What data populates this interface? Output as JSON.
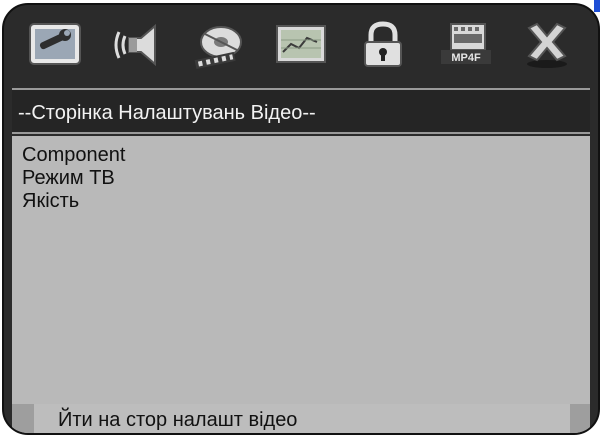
{
  "toolbar": {
    "icons": [
      {
        "name": "general-setup-icon"
      },
      {
        "name": "audio-setup-icon"
      },
      {
        "name": "video-setup-icon"
      },
      {
        "name": "preferences-icon"
      },
      {
        "name": "password-lock-icon"
      },
      {
        "name": "mp4-setup-icon"
      },
      {
        "name": "exit-icon"
      }
    ]
  },
  "header": {
    "title": "--Сторінка Налаштувань Відео--"
  },
  "menu": {
    "items": [
      {
        "label": "Component"
      },
      {
        "label": "Режим ТВ"
      },
      {
        "label": "Якість"
      }
    ]
  },
  "footer": {
    "hint": "Йти на стор налашт відео"
  },
  "colors": {
    "frame": "#2b2b2b",
    "header_bg": "#252525",
    "content_bg": "#b9b9b9",
    "accent_blue": "#1f4fd6"
  }
}
